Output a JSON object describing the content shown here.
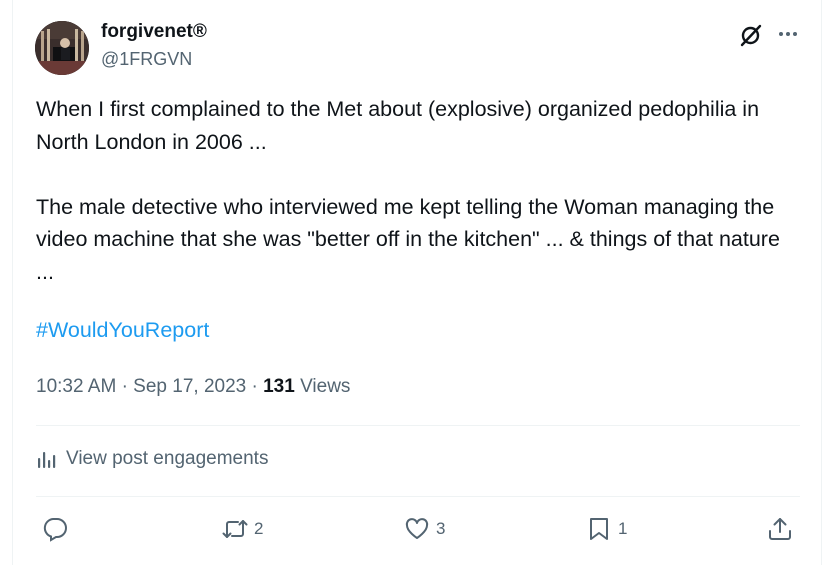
{
  "author": {
    "display_name": "forgivenet®",
    "handle": "@1FRGVN"
  },
  "post": {
    "paragraphs": [
      "When I first complained to the Met about (explosive) organized pedophilia in North London in 2006 ...",
      "The male detective who interviewed me kept telling the Woman managing the video machine that she was \"better off in the kitchen\" ... & things of that nature ..."
    ],
    "hashtag": "#WouldYouReport",
    "time": "10:32 AM",
    "separator": "·",
    "date": "Sep 17, 2023",
    "views_count": "131",
    "views_label": "Views"
  },
  "engagements_label": "View post engagements",
  "actions": {
    "reply_count": "",
    "repost_count": "2",
    "like_count": "3",
    "bookmark_count": "1"
  },
  "icons": [
    "grok-icon",
    "more-icon",
    "analytics-icon",
    "reply-icon",
    "repost-icon",
    "like-icon",
    "bookmark-icon",
    "share-icon"
  ],
  "colors": {
    "text": "#0f1419",
    "secondary": "#536471",
    "link": "#1d9bf0",
    "divider": "#eff3f4"
  }
}
